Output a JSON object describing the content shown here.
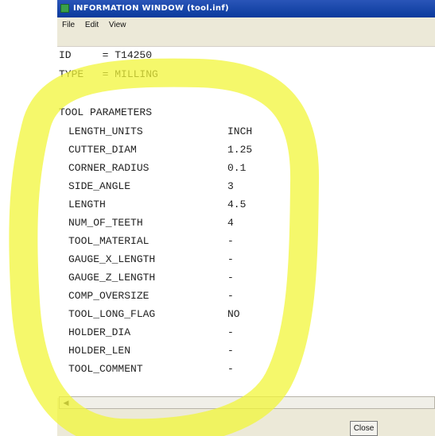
{
  "window": {
    "title": "INFORMATION WINDOW (tool.inf)"
  },
  "menu": [
    {
      "label": "File"
    },
    {
      "label": "Edit"
    },
    {
      "label": "View"
    }
  ],
  "info": {
    "id_line": "ID     = T14250",
    "type_line": "TYPE   = MILLING",
    "section_header": "TOOL PARAMETERS",
    "params": [
      {
        "name": "LENGTH_UNITS",
        "value": "INCH"
      },
      {
        "name": "CUTTER_DIAM",
        "value": "1.25"
      },
      {
        "name": "CORNER_RADIUS",
        "value": "0.1"
      },
      {
        "name": "SIDE_ANGLE",
        "value": "3"
      },
      {
        "name": "LENGTH",
        "value": "4.5"
      },
      {
        "name": "NUM_OF_TEETH",
        "value": "4"
      },
      {
        "name": "TOOL_MATERIAL",
        "value": "-"
      },
      {
        "name": "GAUGE_X_LENGTH",
        "value": "-"
      },
      {
        "name": "GAUGE_Z_LENGTH",
        "value": "-"
      },
      {
        "name": "COMP_OVERSIZE",
        "value": "-"
      },
      {
        "name": "TOOL_LONG_FLAG",
        "value": "NO"
      },
      {
        "name": "HOLDER_DIA",
        "value": "-"
      },
      {
        "name": "HOLDER_LEN",
        "value": "-"
      },
      {
        "name": "TOOL_COMMENT",
        "value": "-"
      }
    ]
  },
  "buttons": {
    "close_label": "Close"
  },
  "colors": {
    "highlight": "#f2f53a",
    "titlebar": "#0a3a9c"
  }
}
